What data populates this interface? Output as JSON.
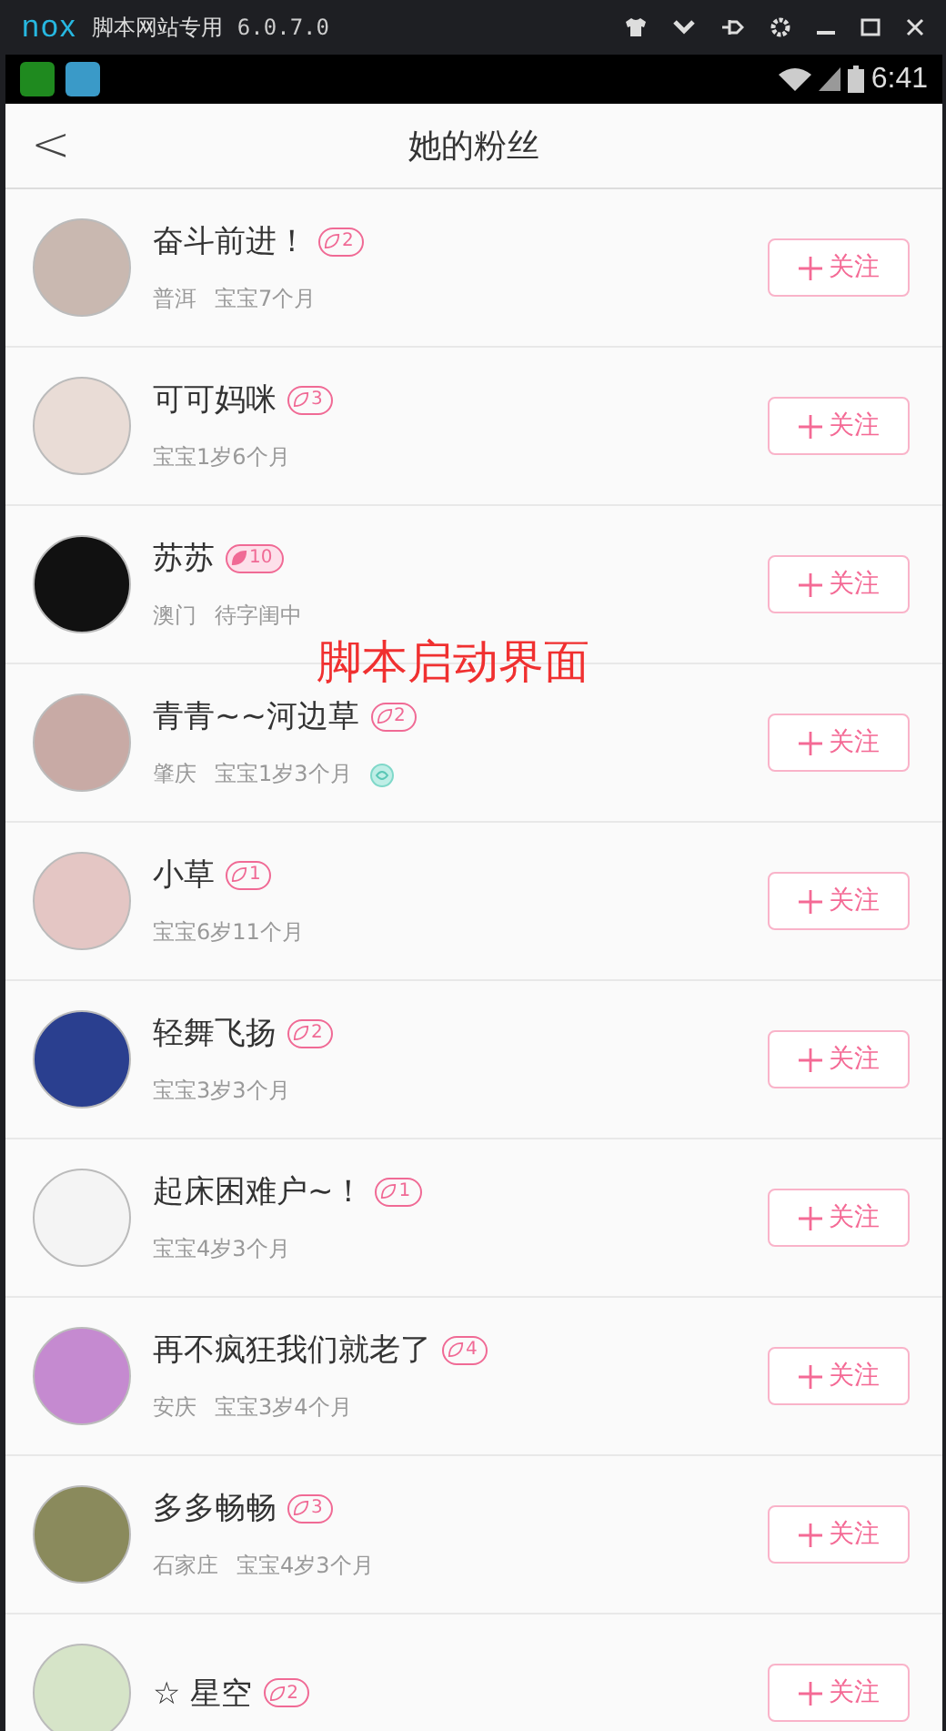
{
  "window": {
    "brand": "nox",
    "title": "脚本网站专用",
    "version": "6.0.7.0"
  },
  "status_bar": {
    "time": "6:41"
  },
  "header": {
    "back": "<",
    "title": "她的粉丝"
  },
  "overlay_label": "脚本启动界面",
  "fans": [
    {
      "name": "奋斗前进！",
      "level": "2",
      "kind": "leaf",
      "meta": [
        "普洱",
        "宝宝7个月"
      ],
      "emblem": false,
      "follow": "关注"
    },
    {
      "name": "可可妈咪",
      "level": "3",
      "kind": "leaf",
      "meta": [
        "宝宝1岁6个月"
      ],
      "emblem": false,
      "follow": "关注"
    },
    {
      "name": "苏苏",
      "level": "10",
      "kind": "filled",
      "meta": [
        "澳门",
        "待字闺中"
      ],
      "emblem": false,
      "follow": "关注"
    },
    {
      "name": "青青~~河边草",
      "level": "2",
      "kind": "leaf",
      "meta": [
        "肇庆",
        "宝宝1岁3个月"
      ],
      "emblem": true,
      "follow": "关注"
    },
    {
      "name": "小草",
      "level": "1",
      "kind": "leaf",
      "meta": [
        "宝宝6岁11个月"
      ],
      "emblem": false,
      "follow": "关注"
    },
    {
      "name": "轻舞飞扬",
      "level": "2",
      "kind": "leaf",
      "meta": [
        "宝宝3岁3个月"
      ],
      "emblem": false,
      "follow": "关注"
    },
    {
      "name": "起床困难户~！",
      "level": "1",
      "kind": "leaf",
      "meta": [
        "宝宝4岁3个月"
      ],
      "emblem": false,
      "follow": "关注"
    },
    {
      "name": "再不疯狂我们就老了",
      "level": "4",
      "kind": "leaf",
      "meta": [
        "安庆",
        "宝宝3岁4个月"
      ],
      "emblem": false,
      "follow": "关注"
    },
    {
      "name": "多多畅畅",
      "level": "3",
      "kind": "leaf",
      "meta": [
        "石家庄",
        "宝宝4岁3个月"
      ],
      "emblem": false,
      "follow": "关注"
    },
    {
      "name": "☆ 星空",
      "level": "2",
      "kind": "leaf",
      "follow": "关注"
    }
  ]
}
